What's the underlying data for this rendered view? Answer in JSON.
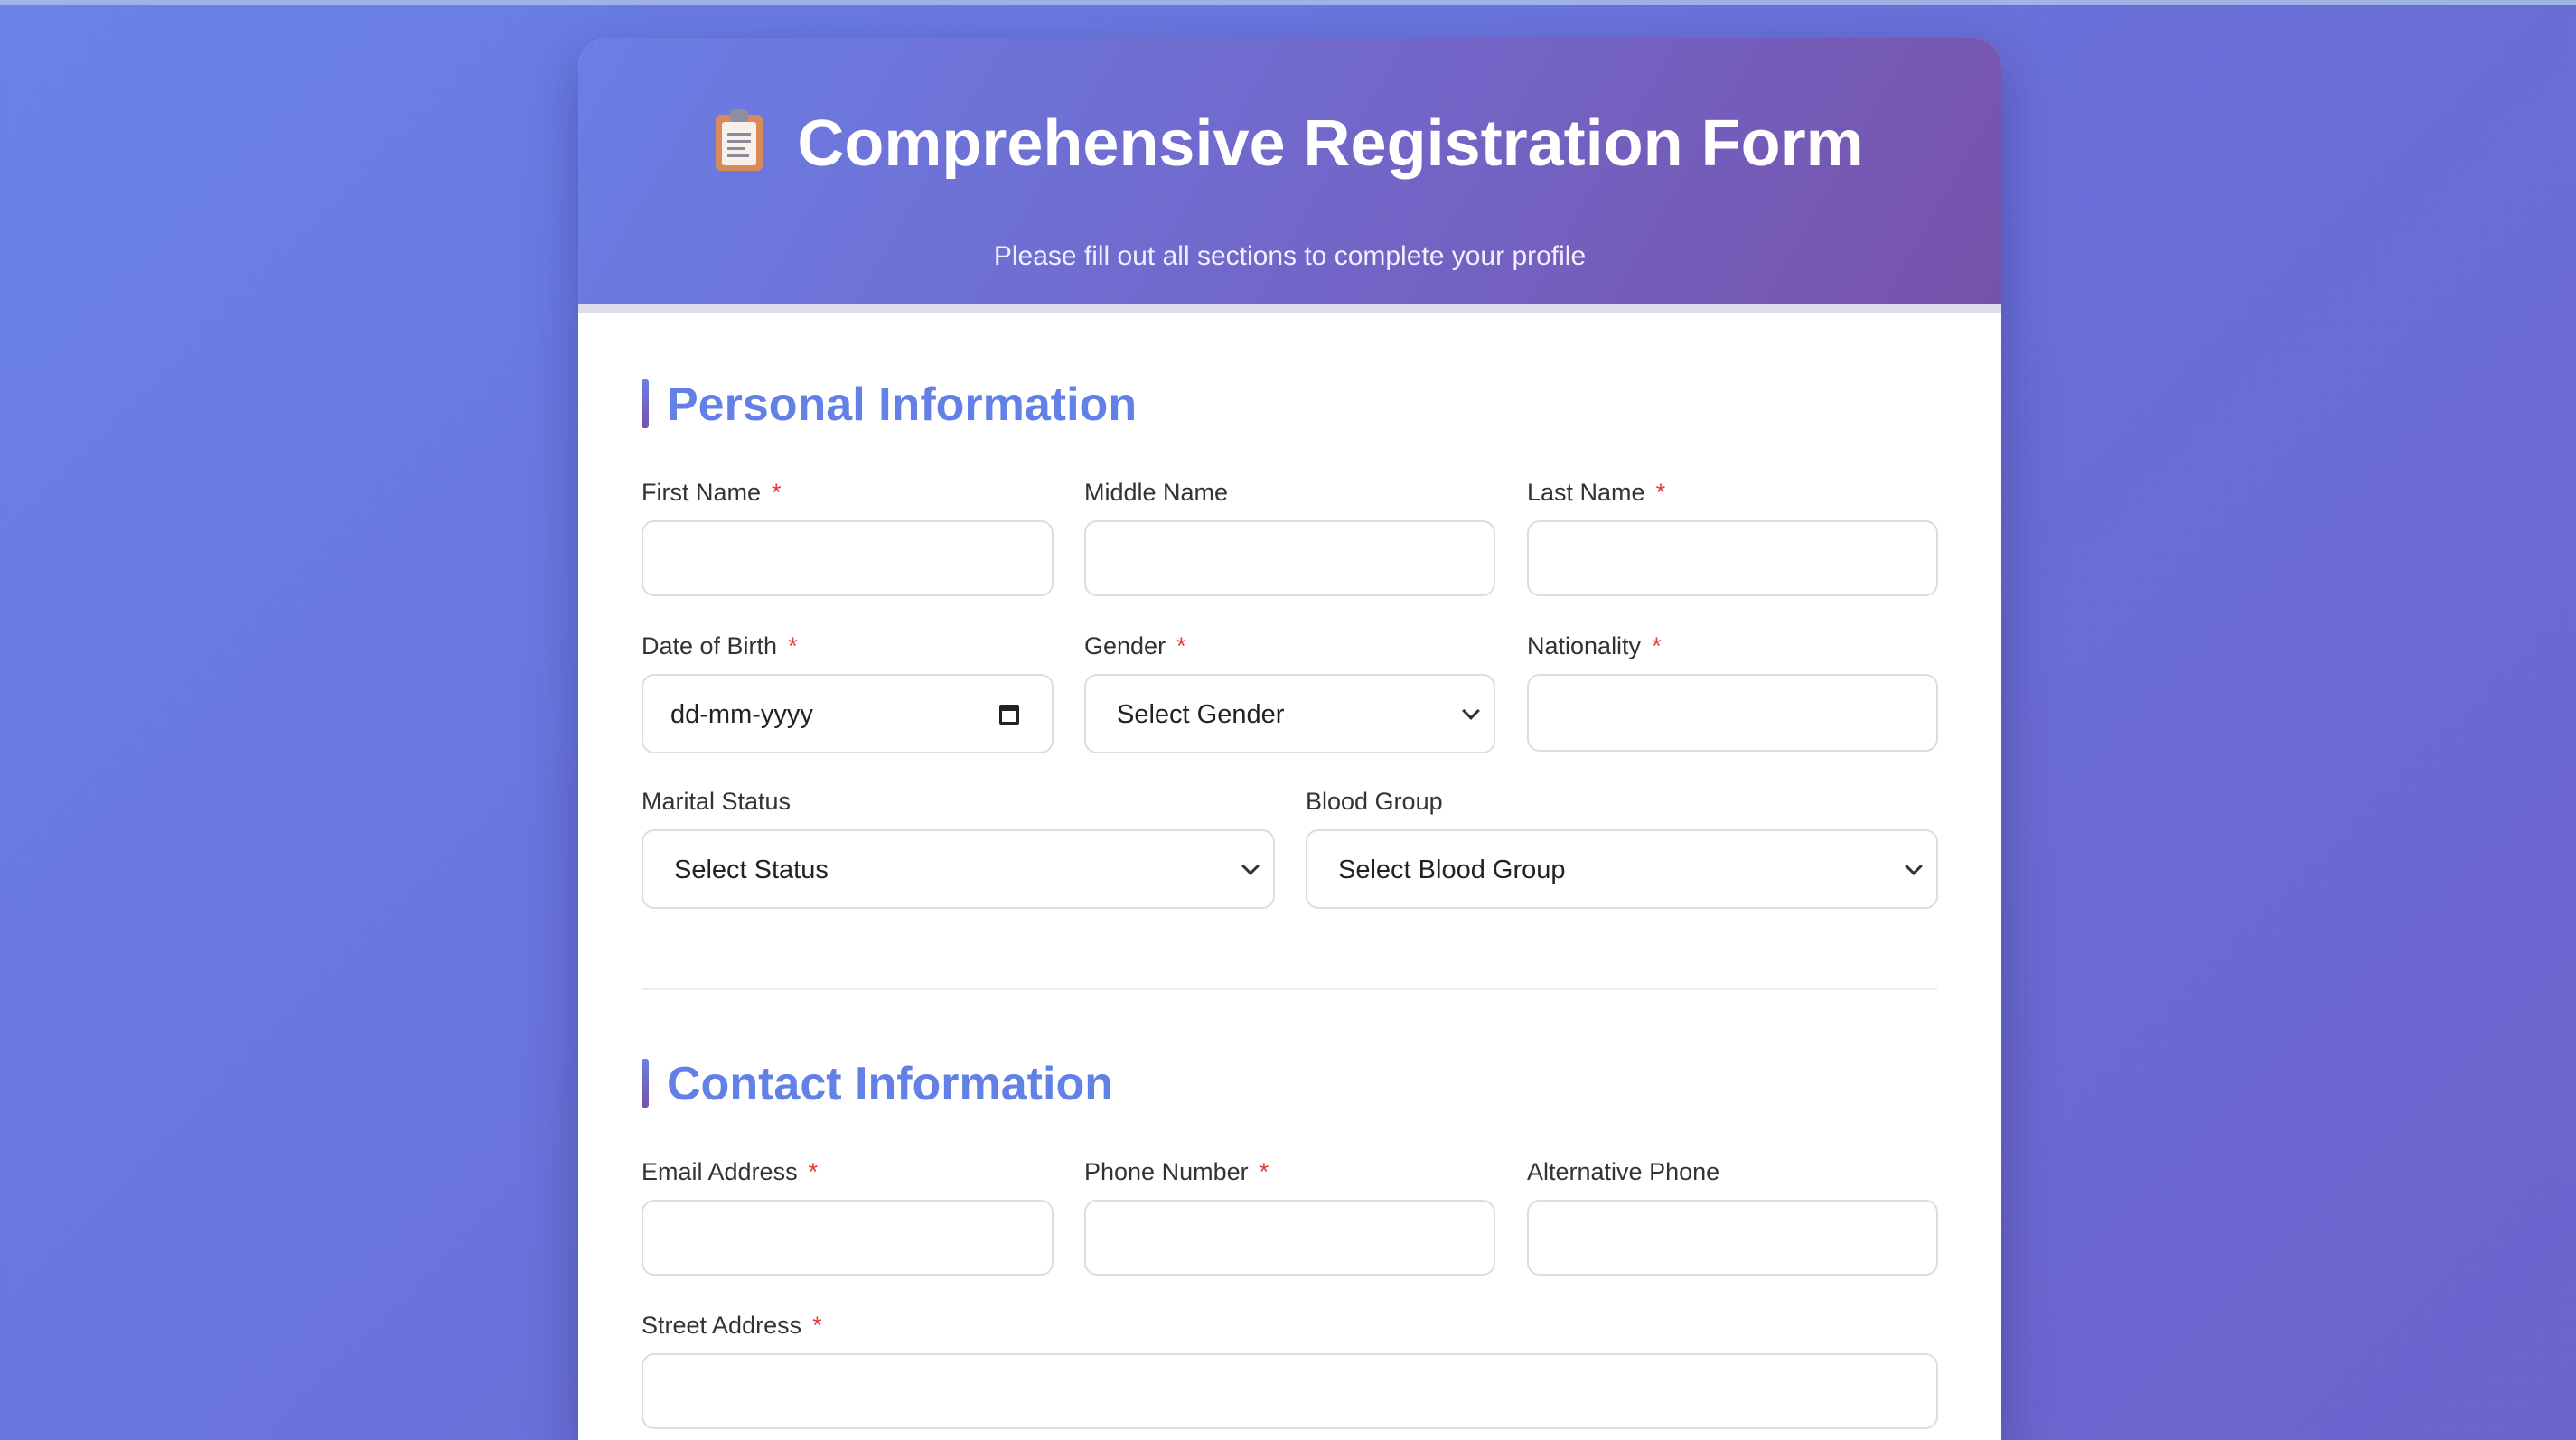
{
  "header": {
    "icon": "clipboard-icon",
    "title": "Comprehensive Registration Form",
    "subtitle": "Please fill out all sections to complete your profile"
  },
  "personal": {
    "title": "Personal Information",
    "first_name": {
      "label": "First Name",
      "required": "*",
      "value": ""
    },
    "middle_name": {
      "label": "Middle Name",
      "value": ""
    },
    "last_name": {
      "label": "Last Name",
      "required": "*",
      "value": ""
    },
    "dob": {
      "label": "Date of Birth",
      "required": "*",
      "placeholder": "dd-mm-yyyy"
    },
    "gender": {
      "label": "Gender",
      "required": "*",
      "selected": "Select Gender"
    },
    "nationality": {
      "label": "Nationality",
      "required": "*",
      "value": ""
    },
    "marital_status": {
      "label": "Marital Status",
      "selected": "Select Status"
    },
    "blood_group": {
      "label": "Blood Group",
      "selected": "Select Blood Group"
    }
  },
  "contact": {
    "title": "Contact Information",
    "email": {
      "label": "Email Address",
      "required": "*",
      "value": ""
    },
    "phone": {
      "label": "Phone Number",
      "required": "*",
      "value": ""
    },
    "alt_phone": {
      "label": "Alternative Phone",
      "value": ""
    },
    "street": {
      "label": "Street Address",
      "required": "*",
      "value": ""
    }
  },
  "colors": {
    "accent": "#6280e6",
    "header_start": "#6a7fe6",
    "header_end": "#7752aa",
    "required": "#e53935"
  }
}
